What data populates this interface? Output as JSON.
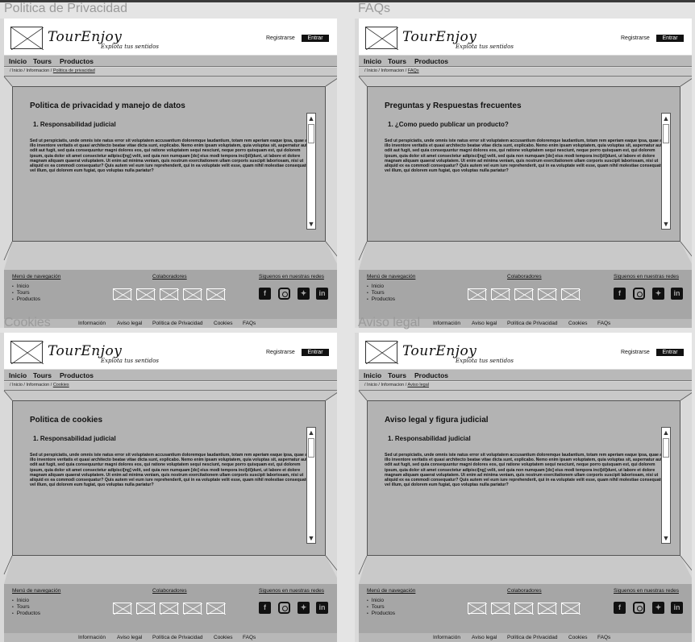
{
  "frames": [
    {
      "frame_title": "Politica de Privacidad",
      "brand": "TourEnjoy",
      "tagline": "Explota tus sentidos",
      "register_label": "Registrarse",
      "login_label": "Entrar",
      "nav": [
        "Inicio",
        "Tours",
        "Productos"
      ],
      "breadcrumb_prefix": "/ Inicio / Informacion / ",
      "breadcrumb_current": "Politica de privacidad",
      "card_title": "Politica de privacidad y manejo de datos",
      "card_subtitle": "1.  Responsabilidad judicial",
      "card_body": "Sed ut perspiciatis, unde omnis iste natus error sit voluptatem accusantium doloremque laudantium, totam rem aperiam eaque ipsa, quae ab illo inventore veritatis et quasi architecto beatae vitae dicta sunt, explicabo. Nemo enim ipsam voluptatem, quia voluptas sit, aspernatur aut odit aut fugit, sed quia consequuntur magni dolores eos, qui ratione voluptatem sequi nesciunt, neque porro quisquam est, qui dolorem ipsum, quia dolor sit amet consectetur adipisci[ng] velit, sed quia non numquam  [do] eius modi tempora inci[di]dunt, ut labore et dolore magnam aliquam quaerat voluptatem. Ut enim ad minima veniam, quis nostrum exercitationem ullam corporis suscipit laboriosam, nisi ut aliquid ex ea commodi consequatur? Quis autem vel eum iure reprehenderit, qui in ea voluptate velit esse, quam nihil molestiae consequatur, vel illum, qui dolorem eum fugiat, quo voluptas nulla pariatur?",
      "footer_nav_heading": "Menú de navegación",
      "footer_nav_items": [
        "Inicio",
        "Tours",
        "Productos"
      ],
      "footer_collab_heading": "Colaboradores",
      "footer_social_heading": "Siguenos en nuestras redes",
      "bottom_links": [
        "Información",
        "Aviso legal",
        "Política de Privacidad",
        "Cookies",
        "FAQs"
      ]
    },
    {
      "frame_title": "FAQs",
      "brand": "TourEnjoy",
      "tagline": "Explota tus sentidos",
      "register_label": "Registrarse",
      "login_label": "Entrar",
      "nav": [
        "Inicio",
        "Tours",
        "Productos"
      ],
      "breadcrumb_prefix": "/ Inicio / Informacion / ",
      "breadcrumb_current": "FAQs",
      "card_title": "Preguntas y Respuestas frecuentes",
      "card_subtitle": "1.  ¿Como puedo publicar un producto?",
      "card_body": "Sed ut perspiciatis, unde omnis iste natus error sit voluptatem accusantium doloremque laudantium, totam rem aperiam eaque ipsa, quae ab illo inventore veritatis et quasi architecto beatae vitae dicta sunt, explicabo. Nemo enim ipsam voluptatem, quia voluptas sit, aspernatur aut odit aut fugit, sed quia consequuntur magni dolores eos, qui ratione voluptatem sequi nesciunt, neque porro quisquam est, qui dolorem ipsum, quia dolor sit amet consectetur adipisci[ng] velit, sed quia non numquam  [do] eius modi tempora inci[di]dunt, ut labore et dolore magnam aliquam quaerat voluptatem. Ut enim ad minima veniam, quis nostrum exercitationem ullam corporis suscipit laboriosam, nisi ut aliquid ex ea commodi consequatur? Quis autem vel eum iure reprehenderit, qui in ea voluptate velit esse, quam nihil molestiae consequatur, vel illum, qui dolorem eum fugiat, quo voluptas nulla pariatur?",
      "footer_nav_heading": "Menú de navegación",
      "footer_nav_items": [
        "Inicio",
        "Tours",
        "Productos"
      ],
      "footer_collab_heading": "Colaboradores",
      "footer_social_heading": "Siguenos en nuestras redes",
      "bottom_links": [
        "Información",
        "Aviso legal",
        "Política de Privacidad",
        "Cookies",
        "FAQs"
      ]
    },
    {
      "frame_title": "Cookies",
      "brand": "TourEnjoy",
      "tagline": "Explota tus sentidos",
      "register_label": "Registrarse",
      "login_label": "Entrar",
      "nav": [
        "Inicio",
        "Tours",
        "Productos"
      ],
      "breadcrumb_prefix": "/ Inicio / Informacion / ",
      "breadcrumb_current": "Cookies",
      "card_title": "Politica de cookies",
      "card_subtitle": "1.  Responsabilidad judicial",
      "card_body": "Sed ut perspiciatis, unde omnis iste natus error sit voluptatem accusantium doloremque laudantium, totam rem aperiam eaque ipsa, quae ab illo inventore veritatis et quasi architecto beatae vitae dicta sunt, explicabo. Nemo enim ipsam voluptatem, quia voluptas sit, aspernatur aut odit aut fugit, sed quia consequuntur magni dolores eos, qui ratione voluptatem sequi nesciunt, neque porro quisquam est, qui dolorem ipsum, quia dolor sit amet consectetur adipisci[ng] velit, sed quia non numquam  [do] eius modi tempora inci[di]dunt, ut labore et dolore magnam aliquam quaerat voluptatem. Ut enim ad minima veniam, quis nostrum exercitationem ullam corporis suscipit laboriosam, nisi ut aliquid ex ea commodi consequatur? Quis autem vel eum iure reprehenderit, qui in ea voluptate velit esse, quam nihil molestiae consequatur, vel illum, qui dolorem eum fugiat, quo voluptas nulla pariatur?",
      "footer_nav_heading": "Menú de navegación",
      "footer_nav_items": [
        "Inicio",
        "Tours",
        "Productos"
      ],
      "footer_collab_heading": "Colaboradores",
      "footer_social_heading": "Siguenos en nuestras redes",
      "bottom_links": [
        "Información",
        "Aviso legal",
        "Política de Privacidad",
        "Cookies",
        "FAQs"
      ]
    },
    {
      "frame_title": "Aviso legal",
      "brand": "TourEnjoy",
      "tagline": "Explota tus sentidos",
      "register_label": "Registrarse",
      "login_label": "Entrar",
      "nav": [
        "Inicio",
        "Tours",
        "Productos"
      ],
      "breadcrumb_prefix": "/ Inicio / Informacion / ",
      "breadcrumb_current": "Aviso legal",
      "card_title": "Aviso legal y figura judicial",
      "card_subtitle": "1.  Responsabilidad judicial",
      "card_body": "Sed ut perspiciatis, unde omnis iste natus error sit voluptatem accusantium doloremque laudantium, totam rem aperiam eaque ipsa, quae ab illo inventore veritatis et quasi architecto beatae vitae dicta sunt, explicabo. Nemo enim ipsam voluptatem, quia voluptas sit, aspernatur aut odit aut fugit, sed quia consequuntur magni dolores eos, qui ratione voluptatem sequi nesciunt, neque porro quisquam est, qui dolorem ipsum, quia dolor sit amet consectetur adipisci[ng] velit, sed quia non numquam  [do] eius modi tempora inci[di]dunt, ut labore et dolore magnam aliquam quaerat voluptatem. Ut enim ad minima veniam, quis nostrum exercitationem ullam corporis suscipit laboriosam, nisi ut aliquid ex ea commodi consequatur? Quis autem vel eum iure reprehenderit, qui in ea voluptate velit esse, quam nihil molestiae consequatur, vel illum, qui dolorem eum fugiat, quo voluptas nulla pariatur?",
      "footer_nav_heading": "Menú de navegación",
      "footer_nav_items": [
        "Inicio",
        "Tours",
        "Productos"
      ],
      "footer_collab_heading": "Colaboradores",
      "footer_social_heading": "Siguenos en nuestras redes",
      "bottom_links": [
        "Información",
        "Aviso legal",
        "Política de Privacidad",
        "Cookies",
        "FAQs"
      ]
    }
  ],
  "social_icons": [
    "facebook-icon",
    "instagram-icon",
    "twitter-icon",
    "linkedin-icon"
  ],
  "collaborator_count": 5
}
